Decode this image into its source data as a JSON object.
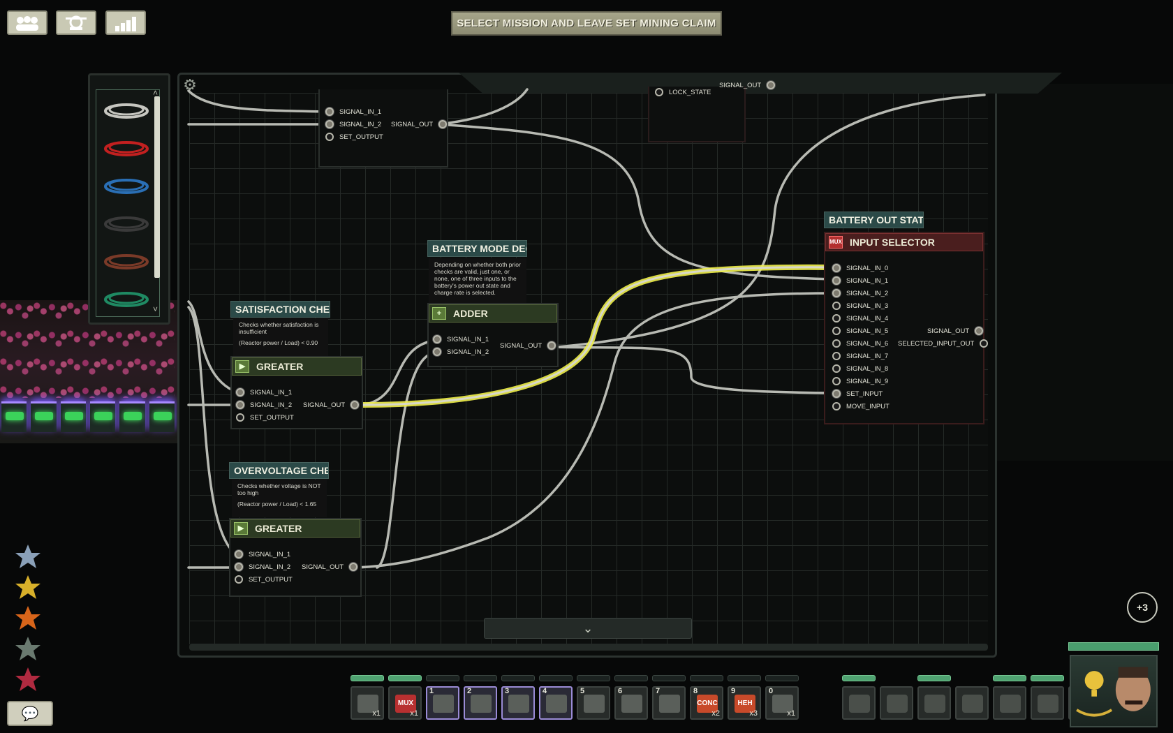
{
  "objective": "SELECT MISSION AND LEAVE SET MINING CLAIM",
  "top_buttons": [
    {
      "icon": "crew-icon"
    },
    {
      "icon": "reputation-icon"
    },
    {
      "icon": "stats-icon"
    }
  ],
  "wire_palette": {
    "colors": [
      "#c6c6c0",
      "#c22020",
      "#2a6fb5",
      "#3a3a3a",
      "#7a3a28",
      "#1f8a63"
    ]
  },
  "nodes": {
    "top_partial": {
      "inputs": [
        "SIGNAL_IN_1",
        "SIGNAL_IN_2",
        "SET_OUTPUT"
      ],
      "output": "SIGNAL_OUT"
    },
    "top_lock": {
      "input": "LOCK_STATE",
      "output": "SIGNAL_OUT"
    },
    "satisfaction": {
      "label": "SATISFACTION CHECK",
      "desc1": "Checks whether satisfaction is insufficient",
      "desc2": "(Reactor power / Load) < 0.90",
      "type": "GREATER",
      "inputs": [
        "SIGNAL_IN_1",
        "SIGNAL_IN_2",
        "SET_OUTPUT"
      ],
      "output": "SIGNAL_OUT"
    },
    "overvoltage": {
      "label": "OVERVOLTAGE CHECK",
      "desc1": "Checks whether voltage is NOT too high",
      "desc2": "(Reactor power / Load) < 1.65",
      "type": "GREATER",
      "inputs": [
        "SIGNAL_IN_1",
        "SIGNAL_IN_2",
        "SET_OUTPUT"
      ],
      "output": "SIGNAL_OUT"
    },
    "battery_mode": {
      "label": "BATTERY MODE DECI...",
      "desc": "Depending on whether both prior checks are valid, just one, or none, one of three inputs to the battery's power out state and charge rate is selected.",
      "type": "ADDER",
      "inputs": [
        "SIGNAL_IN_1",
        "SIGNAL_IN_2"
      ],
      "output": "SIGNAL_OUT"
    },
    "battery_out": {
      "label": "BATTERY OUT STATE",
      "icon_text": "MUX",
      "type": "INPUT SELECTOR",
      "inputs": [
        "SIGNAL_IN_0",
        "SIGNAL_IN_1",
        "SIGNAL_IN_2",
        "SIGNAL_IN_3",
        "SIGNAL_IN_4",
        "SIGNAL_IN_5",
        "SIGNAL_IN_6",
        "SIGNAL_IN_7",
        "SIGNAL_IN_8",
        "SIGNAL_IN_9",
        "SET_INPUT",
        "MOVE_INPUT"
      ],
      "outputs": [
        "SIGNAL_OUT",
        "SELECTED_INPUT_OUT"
      ]
    }
  },
  "skills": [
    "electrical-skill-icon",
    "mechanical-skill-icon",
    "weapons-skill-icon",
    "medical-skill-icon",
    "helm-skill-icon"
  ],
  "hotbar": [
    {
      "num": "",
      "label": "",
      "count": "x1",
      "icon": "circuit-board-icon",
      "selected": false
    },
    {
      "num": "",
      "label": "MUX",
      "count": "x1",
      "icon": "mux-component-icon",
      "selected": false
    },
    {
      "num": "1",
      "label": "",
      "count": "",
      "icon": "screwdriver-icon",
      "selected": true
    },
    {
      "num": "2",
      "label": "",
      "count": "",
      "icon": "wrench-icon",
      "selected": true
    },
    {
      "num": "3",
      "label": "",
      "count": "",
      "icon": "gun-icon",
      "selected": true
    },
    {
      "num": "4",
      "label": "",
      "count": "",
      "icon": "screwdriver-icon",
      "selected": true
    },
    {
      "num": "5",
      "label": "",
      "count": "",
      "icon": "diving-mask-icon",
      "selected": false
    },
    {
      "num": "6",
      "label": "",
      "count": "",
      "icon": "flashlight-icon",
      "selected": false
    },
    {
      "num": "7",
      "label": "",
      "count": "",
      "icon": "welding-tool-icon",
      "selected": false
    },
    {
      "num": "8",
      "label": "CONC",
      "count": "x2",
      "icon": "concussion-charge-icon",
      "selected": false
    },
    {
      "num": "9",
      "label": "HEH",
      "count": "x3",
      "icon": "explosive-icon",
      "selected": false
    },
    {
      "num": "0",
      "label": "",
      "count": "x1",
      "icon": "battery-cell-icon",
      "selected": false
    }
  ],
  "equipment": [
    "rifle-icon",
    "helmet-icon",
    "body-armor-icon",
    "headset-icon",
    "goggles-icon",
    "hands-icon",
    "id-card-icon"
  ],
  "plus_badge": "+3"
}
